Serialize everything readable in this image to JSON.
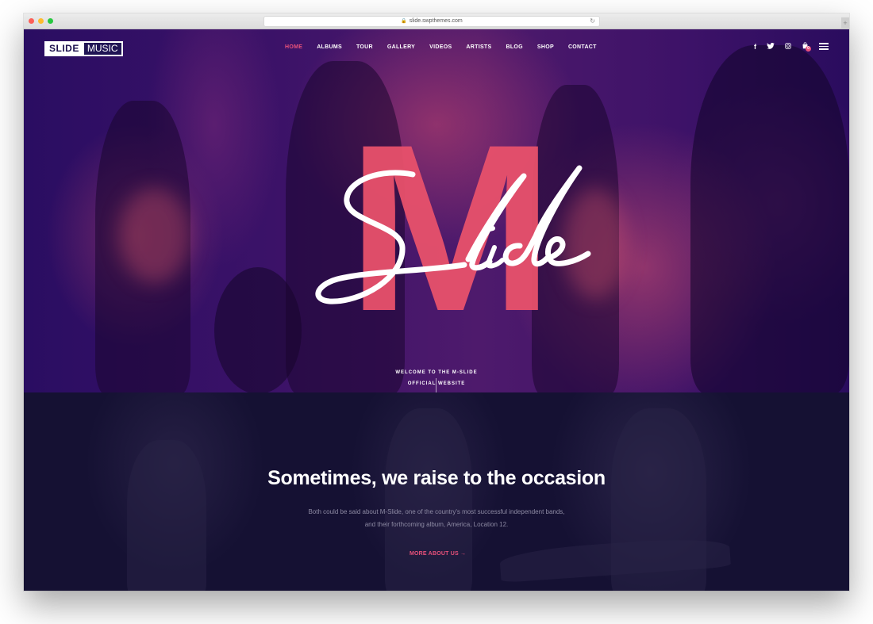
{
  "browser": {
    "url": "slide.swpthemes.com",
    "lock_icon": "🔒",
    "reload_icon": "↻",
    "new_tab_icon": "+"
  },
  "brand": {
    "logo_part1": "SLIDE",
    "logo_part2": "MUSIC",
    "accent_color": "#e8517a",
    "dark_color": "#151133"
  },
  "nav": {
    "items": [
      {
        "label": "HOME",
        "active": true
      },
      {
        "label": "ALBUMS",
        "active": false
      },
      {
        "label": "TOUR",
        "active": false
      },
      {
        "label": "GALLERY",
        "active": false
      },
      {
        "label": "VIDEOS",
        "active": false
      },
      {
        "label": "ARTISTS",
        "active": false
      },
      {
        "label": "BLOG",
        "active": false
      },
      {
        "label": "SHOP",
        "active": false
      },
      {
        "label": "CONTACT",
        "active": false
      }
    ],
    "social": {
      "facebook": "f",
      "twitter": "🐦",
      "instagram": "◎",
      "cart": "🛍",
      "cart_count": "0"
    }
  },
  "hero": {
    "big_letter": "M",
    "script_word": "Slide",
    "welcome_line1": "WELCOME TO THE M-SLIDE",
    "welcome_line2": "OFFICIAL WEBSITE"
  },
  "about": {
    "heading": "Sometimes, we raise to the occasion",
    "body": "Both could be said about M-Slide, one of the country's most successful independent bands, and their forthcoming album, America, Location 12.",
    "cta_label": "MORE ABOUT US",
    "cta_arrow": "→"
  }
}
